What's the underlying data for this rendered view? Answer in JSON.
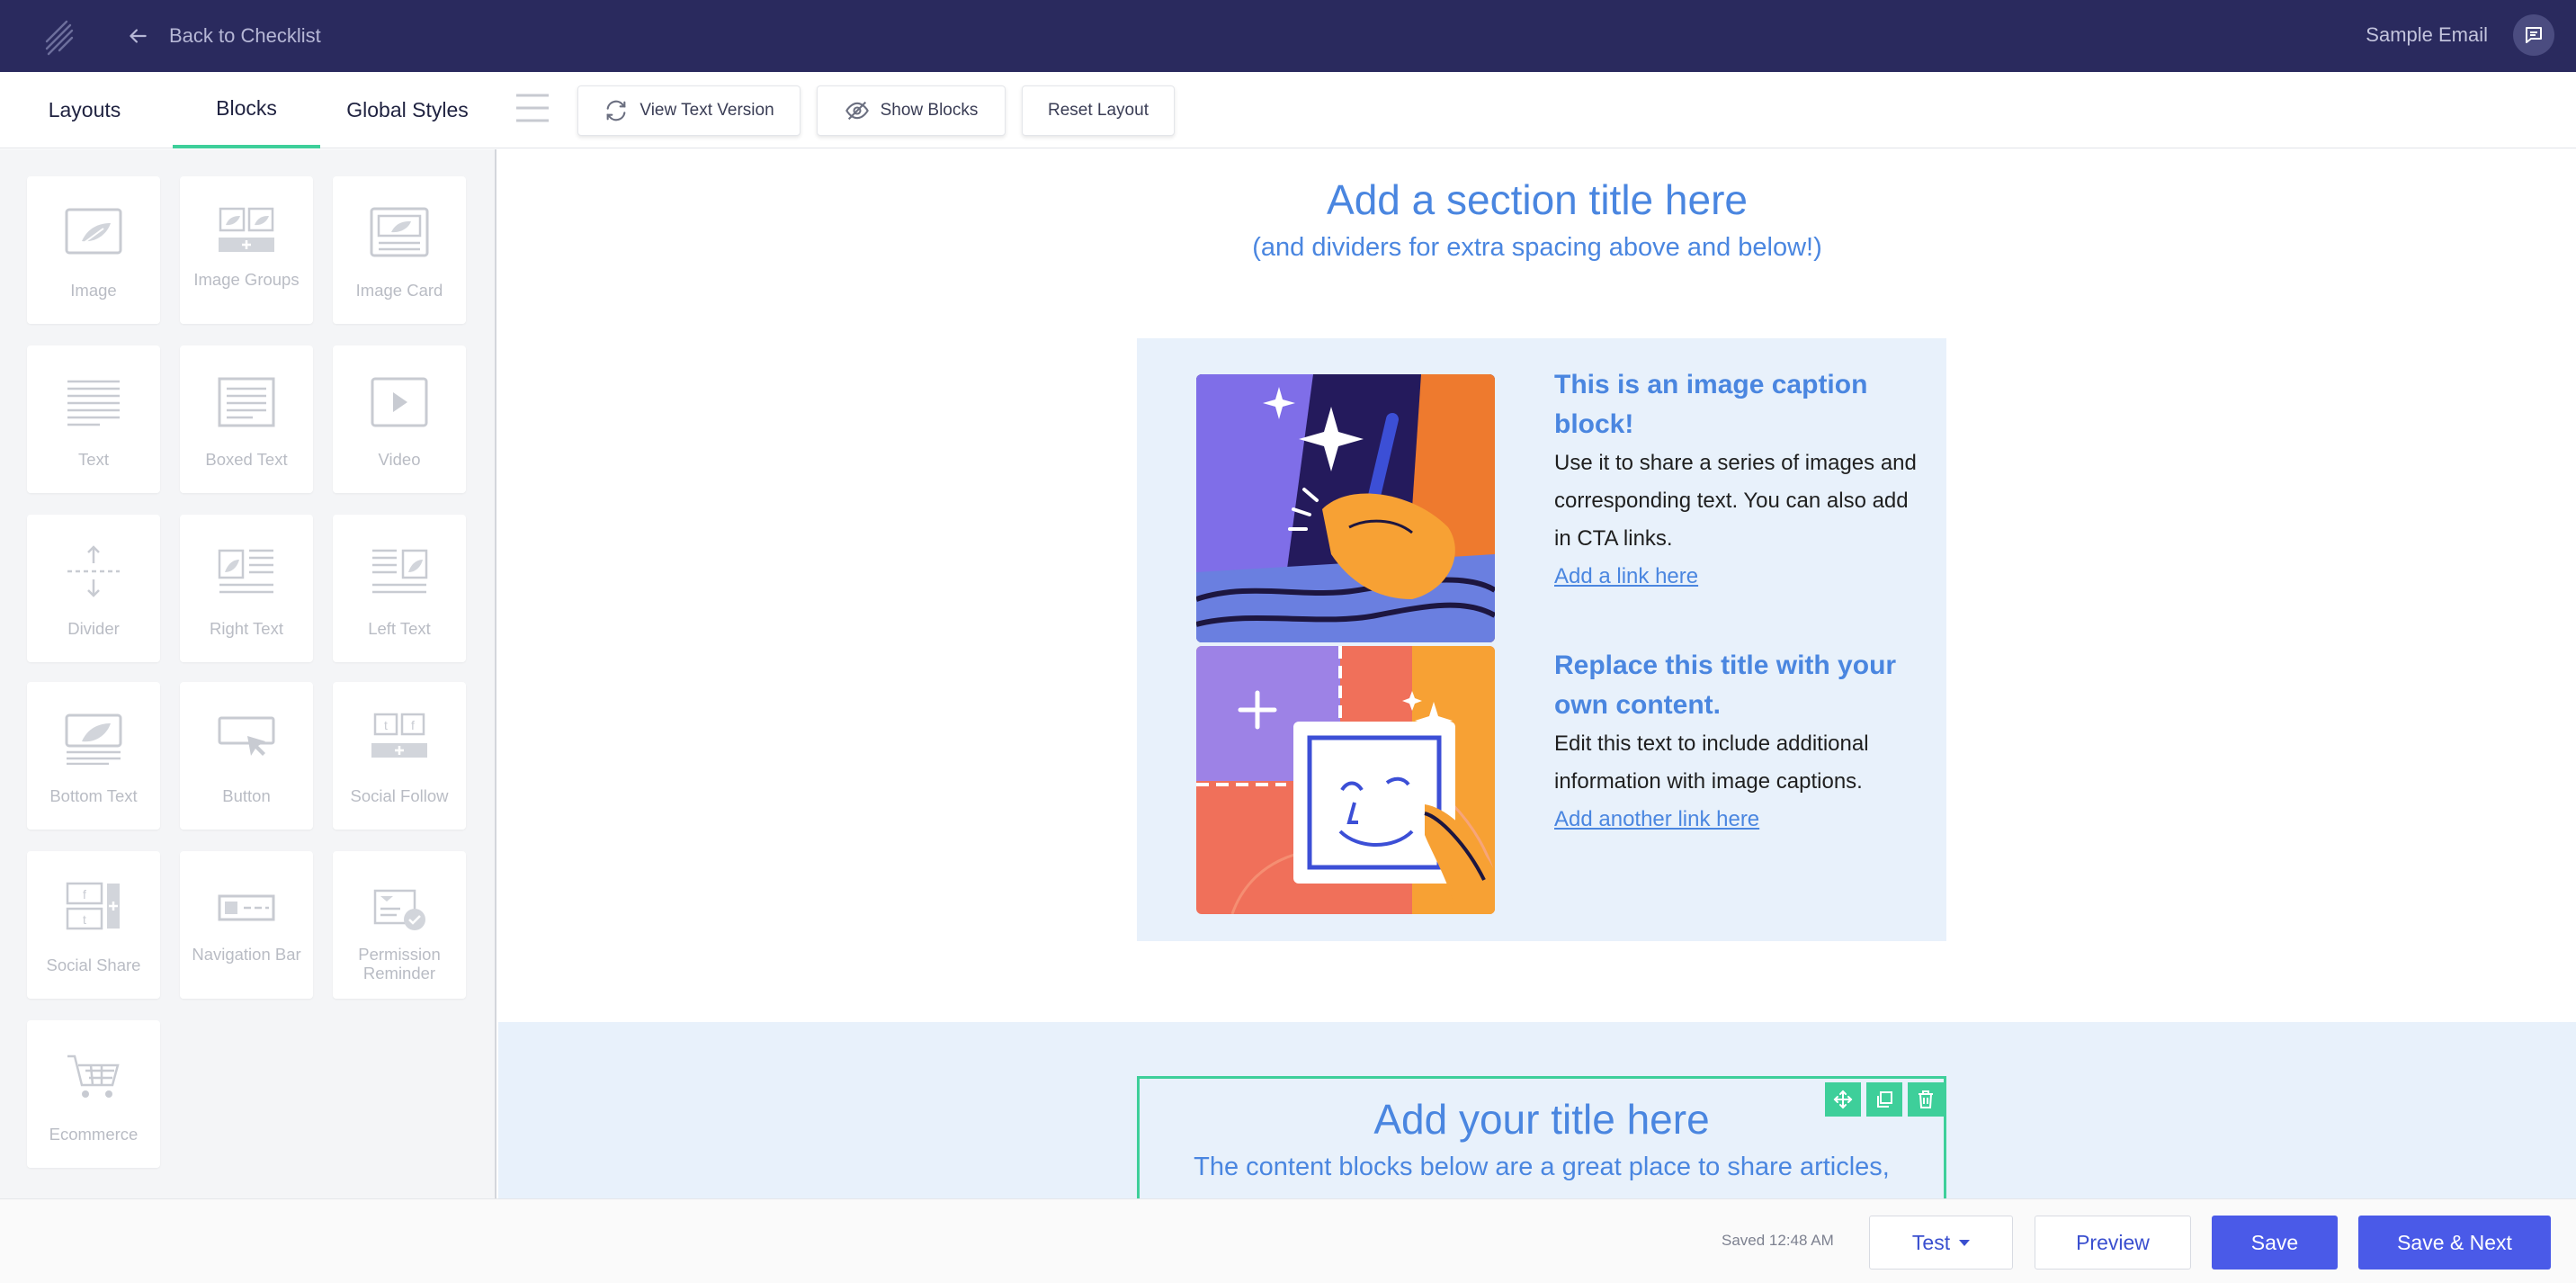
{
  "topbar": {
    "back_label": "Back to Checklist",
    "email_title": "Sample Email"
  },
  "tabs": {
    "layouts": "Layouts",
    "blocks": "Blocks",
    "global_styles": "Global Styles",
    "active": "Blocks"
  },
  "toolbar": {
    "view_text_version": "View Text Version",
    "show_blocks": "Show Blocks",
    "reset_layout": "Reset Layout"
  },
  "sidebar": {
    "blocks": [
      {
        "label": "Image",
        "icon": "image-icon"
      },
      {
        "label": "Image Groups",
        "icon": "image-groups-icon"
      },
      {
        "label": "Image Card",
        "icon": "image-card-icon"
      },
      {
        "label": "Text",
        "icon": "text-icon"
      },
      {
        "label": "Boxed Text",
        "icon": "boxed-text-icon"
      },
      {
        "label": "Video",
        "icon": "video-icon"
      },
      {
        "label": "Divider",
        "icon": "divider-icon"
      },
      {
        "label": "Right Text",
        "icon": "right-text-icon"
      },
      {
        "label": "Left Text",
        "icon": "left-text-icon"
      },
      {
        "label": "Bottom Text",
        "icon": "bottom-text-icon"
      },
      {
        "label": "Button",
        "icon": "button-icon"
      },
      {
        "label": "Social Follow",
        "icon": "social-follow-icon"
      },
      {
        "label": "Social Share",
        "icon": "social-share-icon"
      },
      {
        "label": "Navigation Bar",
        "icon": "navigation-bar-icon"
      },
      {
        "label": "Permission Reminder",
        "icon": "permission-reminder-icon"
      },
      {
        "label": "Ecommerce",
        "icon": "ecommerce-icon"
      }
    ]
  },
  "canvas": {
    "section_title": "Add a section title here",
    "section_subtitle": "(and dividers for extra spacing above and below!)",
    "captions": [
      {
        "title": "This is an image caption block!",
        "body": "Use it to share a series of images and corresponding text. You can also add in CTA links.",
        "link": "Add a link here"
      },
      {
        "title": "Replace this title with your own content.",
        "body": "Edit this text to include additional information with image captions.",
        "link": "Add another link here"
      }
    ],
    "selected_block": {
      "title": "Add your title here",
      "subtitle": "The content blocks below are a great place to share articles,"
    }
  },
  "bottombar": {
    "saved_status": "Saved 12:48 AM",
    "test_label": "Test",
    "preview_label": "Preview",
    "save_label": "Save",
    "save_next_label": "Save & Next"
  },
  "colors": {
    "topbar": "#2a2a5e",
    "accent_green": "#3ecf9a",
    "primary_blue": "#4a5ae8",
    "heading_blue": "#4a86e0",
    "caption_bg": "#e8f1fb"
  }
}
